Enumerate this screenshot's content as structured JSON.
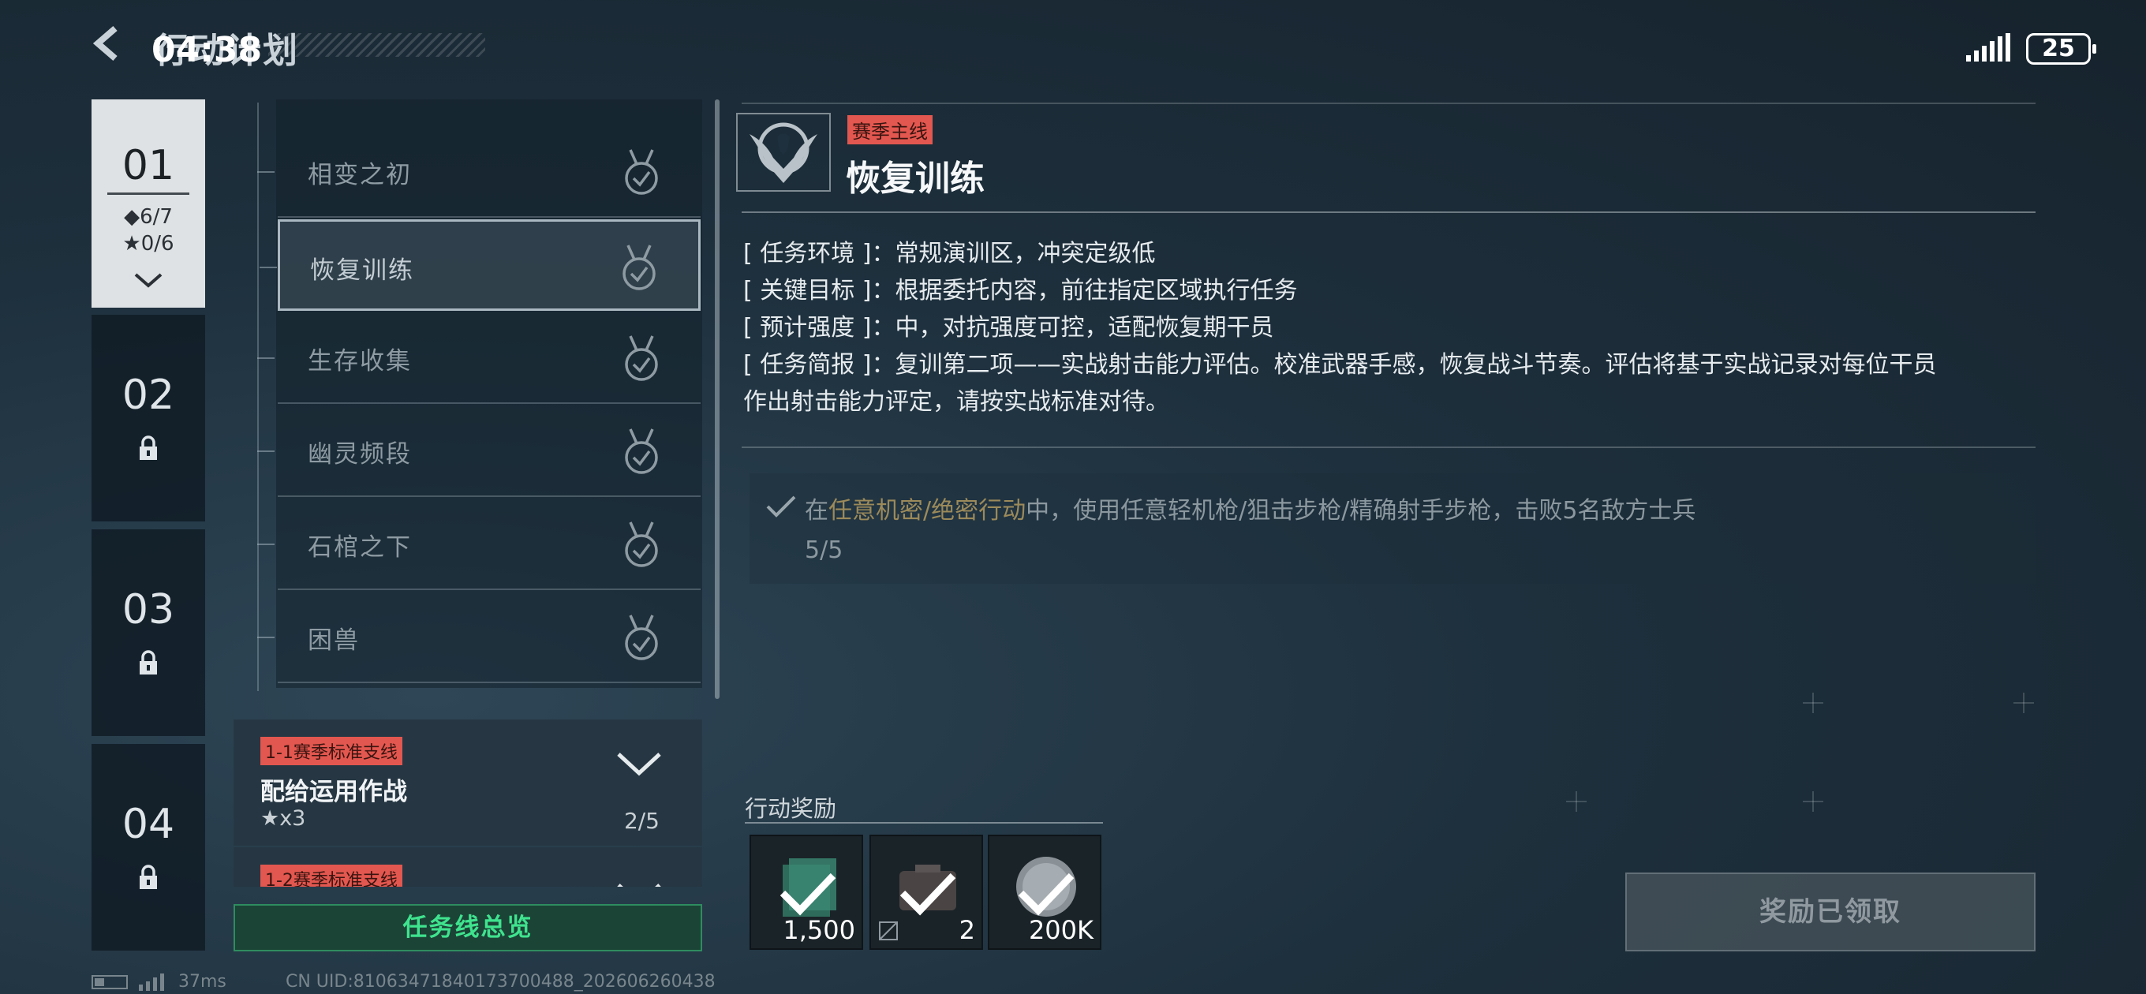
{
  "header": {
    "title": "行动计划",
    "clock": "04:38",
    "battery": "25"
  },
  "chapters": [
    {
      "number": "01",
      "diamonds": "◆6/7",
      "stars": "★0/6",
      "locked": false
    },
    {
      "number": "02",
      "locked": true
    },
    {
      "number": "03",
      "locked": true
    },
    {
      "number": "04",
      "locked": true
    }
  ],
  "missions": [
    {
      "label": "相变之初",
      "completed": true
    },
    {
      "label": "恢复训练",
      "completed": true,
      "selected": true
    },
    {
      "label": "生存收集",
      "completed": true
    },
    {
      "label": "幽灵频段",
      "completed": true
    },
    {
      "label": "石棺之下",
      "completed": true
    },
    {
      "label": "困兽",
      "completed": true
    }
  ],
  "branches": [
    {
      "tag": "1-1赛季标准支线",
      "title": "配给运用作战",
      "stars": "★x3",
      "progress": "2/5"
    },
    {
      "tag": "1-2赛季标准支线"
    }
  ],
  "overview_button": "任务线总览",
  "detail": {
    "tag": "赛季主线",
    "title": "恢复训练",
    "info": [
      "[ 任务环境 ]：常规演训区，冲突定级低",
      "[ 关键目标 ]：根据委托内容，前往指定区域执行任务",
      "[ 预计强度 ]：中，对抗强度可控，适配恢复期干员",
      "[ 任务简报 ]：复训第二项——实战射击能力评估。校准武器手感，恢复战斗节奏。评估将基于实战记录对每位干员",
      "作出射击能力评定，请按实战标准对待。"
    ],
    "objective": {
      "prefix": "在",
      "highlight": "任意机密/绝密行动",
      "suffix": "中，使用任意轻机枪/狙击步枪/精确射手步枪，击败5名敌方士兵",
      "progress": "5/5",
      "completed": true
    }
  },
  "rewards": {
    "title": "行动奖励",
    "items": [
      {
        "icon": "currency-icon",
        "count": "1,500",
        "claimed": true
      },
      {
        "icon": "ammo-box-icon",
        "count": "2",
        "claimed": true,
        "non_tradable": true
      },
      {
        "icon": "coin-icon",
        "count": "200K",
        "claimed": true
      }
    ],
    "claimed_button": "奖励已领取"
  },
  "footer": {
    "ping": "37ms",
    "uid": "CN UID:81063471840173700488_202606260438"
  },
  "colors": {
    "accent_green": "#3fe38e",
    "tag_red": "#e2574f",
    "highlight_gold": "#9c8a5a"
  }
}
